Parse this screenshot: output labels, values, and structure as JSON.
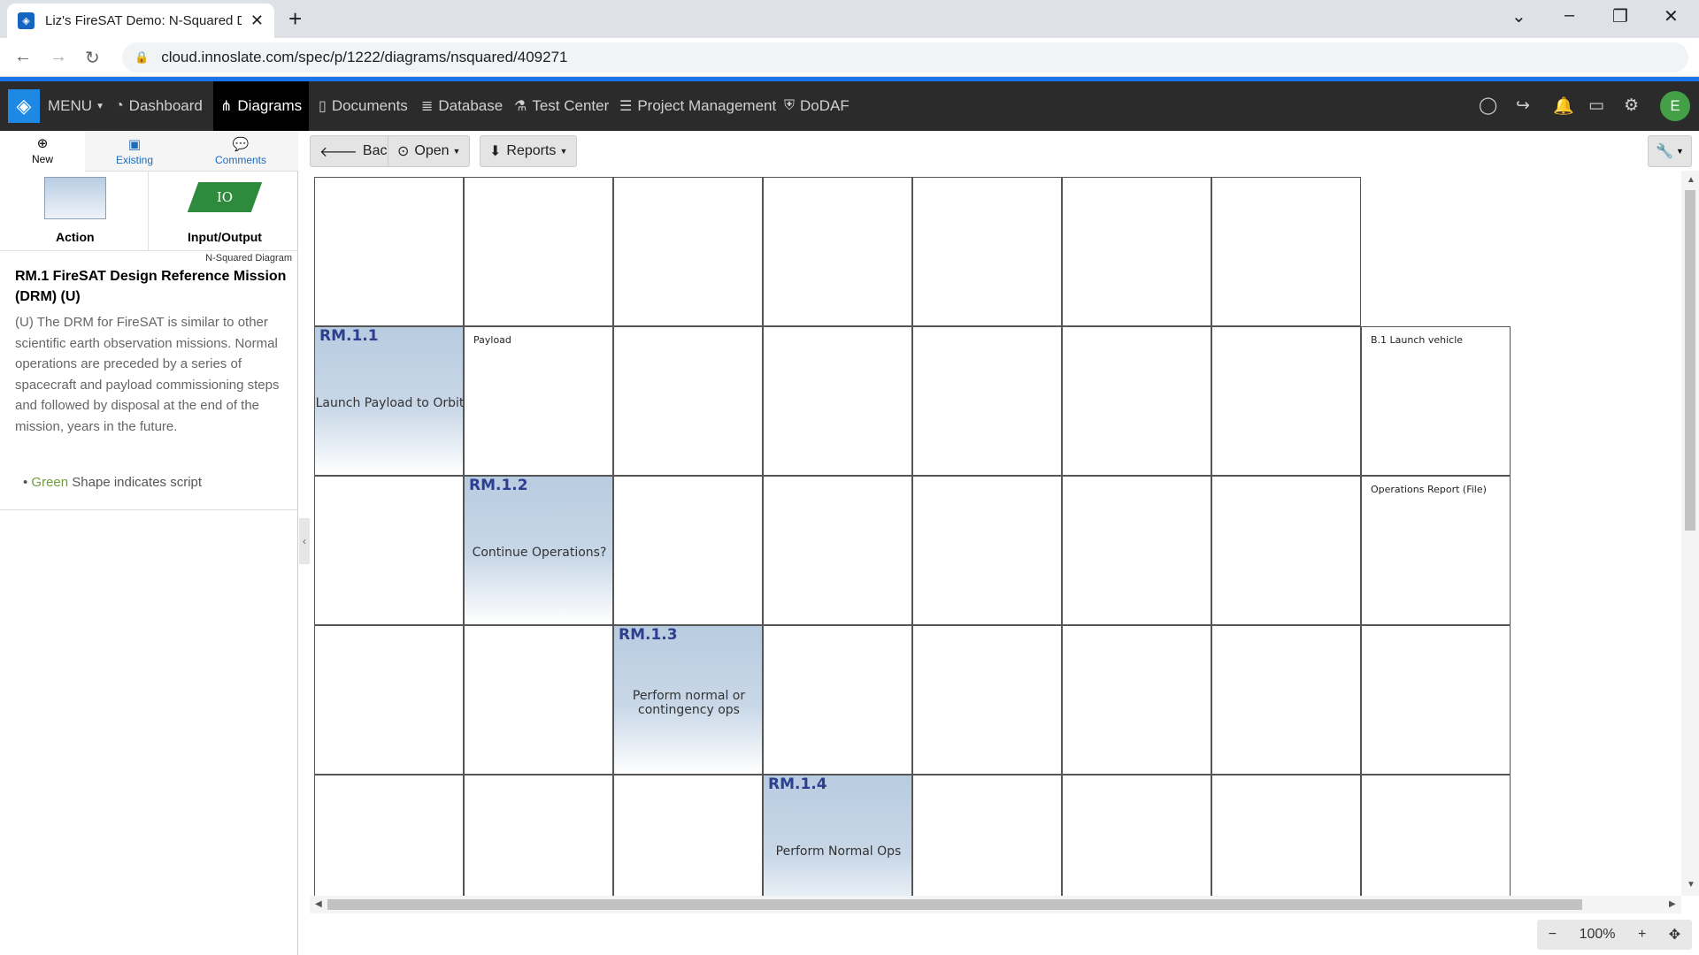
{
  "browser": {
    "tab_title": "Liz's FireSAT Demo: N-Squared D",
    "url": "cloud.innoslate.com/spec/p/1222/diagrams/nsquared/409271"
  },
  "navbar": {
    "menu": "MENU",
    "items": [
      {
        "label": "Dashboard",
        "icon": "dashboard-icon"
      },
      {
        "label": "Diagrams",
        "icon": "diagrams-icon",
        "active": true
      },
      {
        "label": "Documents",
        "icon": "documents-icon"
      },
      {
        "label": "Database",
        "icon": "database-icon"
      },
      {
        "label": "Test Center",
        "icon": "flask-icon"
      },
      {
        "label": "Project Management",
        "icon": "list-icon"
      },
      {
        "label": "DoDAF",
        "icon": "shield-icon"
      }
    ],
    "user_initial": "E"
  },
  "leftpanel": {
    "tabs": [
      {
        "label": "New",
        "icon": "plus-circle-icon"
      },
      {
        "label": "Existing",
        "icon": "archive-icon"
      },
      {
        "label": "Comments",
        "icon": "comments-icon"
      }
    ],
    "palette": {
      "action_label": "Action",
      "io_label": "Input/Output",
      "io_shape_text": "IO"
    },
    "diagram_type": "N-Squared Diagram",
    "title": "RM.1 FireSAT Design Reference Mission (DRM) (U)",
    "description": "(U) The DRM for FireSAT is similar to other scientific earth observation missions. Normal operations are preceded by a series of spacecraft and payload commissioning steps and followed by disposal at the end of the mission, years in the future.",
    "bullet_green": "Green",
    "bullet_rest": " Shape indicates script"
  },
  "toolbar": {
    "back": "Back",
    "open": "Open",
    "reports": "Reports"
  },
  "diagram": {
    "actions": [
      {
        "num": "RM.1.1",
        "name": "Launch Payload to Orbit"
      },
      {
        "num": "RM.1.2",
        "name": "Continue Operations?"
      },
      {
        "num": "RM.1.3",
        "name": "Perform normal or contingency ops"
      },
      {
        "num": "RM.1.4",
        "name": "Perform Normal Ops"
      }
    ],
    "io": {
      "payload": "Payload",
      "launch_vehicle": "B.1 Launch vehicle",
      "ops_report": "Operations Report (File)"
    }
  },
  "zoom": {
    "level": "100%"
  }
}
